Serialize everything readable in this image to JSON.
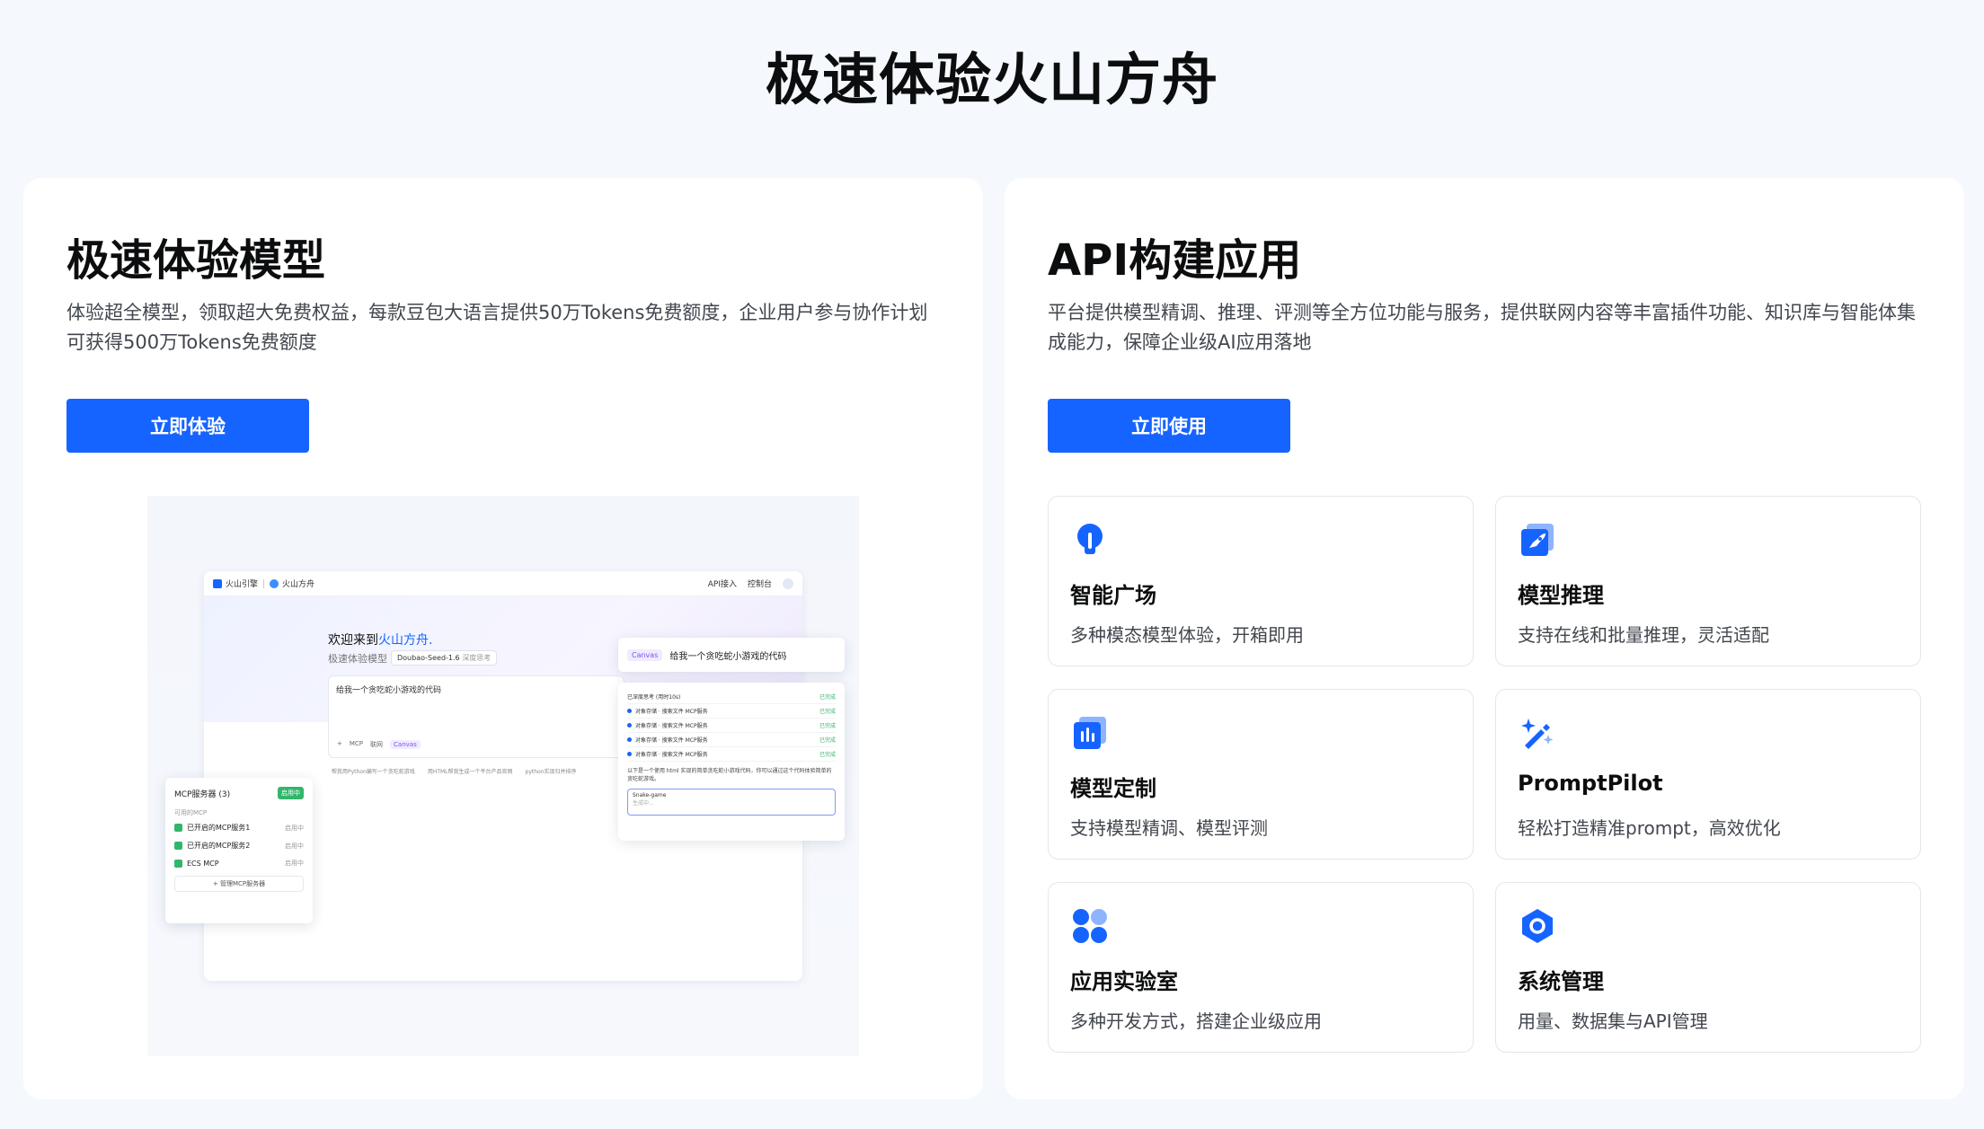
{
  "page": {
    "title": "极速体验火山方舟"
  },
  "left_card": {
    "title": "极速体验模型",
    "desc_line1": "体验超全模型，领取超大免费权益，每款豆包大语言提供50万Tokens免费额度，企业用户参与协作计划",
    "desc_line2": "可获得500万Tokens免费额度",
    "button": "立即体验",
    "preview": {
      "brand1": "火山引擎",
      "brand2": "火山方舟",
      "top_right": [
        "API接入",
        "控制台"
      ],
      "welcome_prefix": "欢迎来到",
      "welcome_highlight": "火山方舟",
      "welcome_suffix": ".",
      "sub_label": "极速体验模型",
      "model_pill": "Doubao-Seed-1.6",
      "mode_pill": "深度思考",
      "input_text": "给我一个贪吃蛇小游戏的代码",
      "tools": [
        "+",
        "MCP",
        "联网",
        "Canvas"
      ],
      "suggestions": [
        "帮我用Python编写一个贪吃蛇游戏",
        "用HTML帮我生成一个平台产品官网",
        "python实现归并排序"
      ],
      "mcp": {
        "title": "MCP服务器 (3)",
        "badge": "启用中",
        "available": "可用的MCP",
        "items": [
          {
            "name": "已开启的MCP服务1",
            "status": "启用中"
          },
          {
            "name": "已开启的MCP服务2",
            "status": "启用中"
          },
          {
            "name": "ECS MCP",
            "status": "启用中"
          }
        ],
        "manage": "+ 管理MCP服务器"
      },
      "canvas_bar": {
        "tag": "Canvas",
        "text": "给我一个贪吃蛇小游戏的代码"
      },
      "result": {
        "header": "已深度思考 (用时10s)",
        "header_status": "已完成",
        "lines": [
          {
            "text": "对象存储 · 搜索文件 MCP服务",
            "status": "已完成"
          },
          {
            "text": "对象存储 · 搜索文件 MCP服务",
            "status": "已完成"
          },
          {
            "text": "对象存储 · 搜索文件 MCP服务",
            "status": "已完成"
          },
          {
            "text": "对象存储 · 搜索文件 MCP服务",
            "status": "已完成"
          }
        ],
        "summary": "以下是一个使用 html 实现的简单贪吃蛇小游戏代码，你可以通过这个代码体验简单的贪吃蛇游戏。",
        "code_title": "Snake-game",
        "code_sub": "生成中..."
      }
    }
  },
  "right_card": {
    "title": "API构建应用",
    "desc_line1": "平台提供模型精调、推理、评测等全方位功能与服务，提供联网内容等丰富插件功能、知识库与智能体集",
    "desc_line2": "成能力，保障企业级AI应用落地",
    "button": "立即使用",
    "features": [
      {
        "title": "智能广场",
        "desc": "多种模态模型体验，开箱即用",
        "icon": "lightbulb-icon"
      },
      {
        "title": "模型推理",
        "desc": "支持在线和批量推理，灵活适配",
        "icon": "rocket-icon"
      },
      {
        "title": "模型定制",
        "desc": "支持模型精调、模型评测",
        "icon": "customize-icon"
      },
      {
        "title": "PromptPilot",
        "desc": "轻松打造精准prompt，高效优化",
        "icon": "magic-wand-icon"
      },
      {
        "title": "应用实验室",
        "desc": "多种开发方式，搭建企业级应用",
        "icon": "apps-icon"
      },
      {
        "title": "系统管理",
        "desc": "用量、数据集与API管理",
        "icon": "gear-hexagon-icon"
      }
    ]
  },
  "colors": {
    "primary": "#1664ff",
    "success": "#33b66c",
    "canvas": "#7b53e8"
  }
}
